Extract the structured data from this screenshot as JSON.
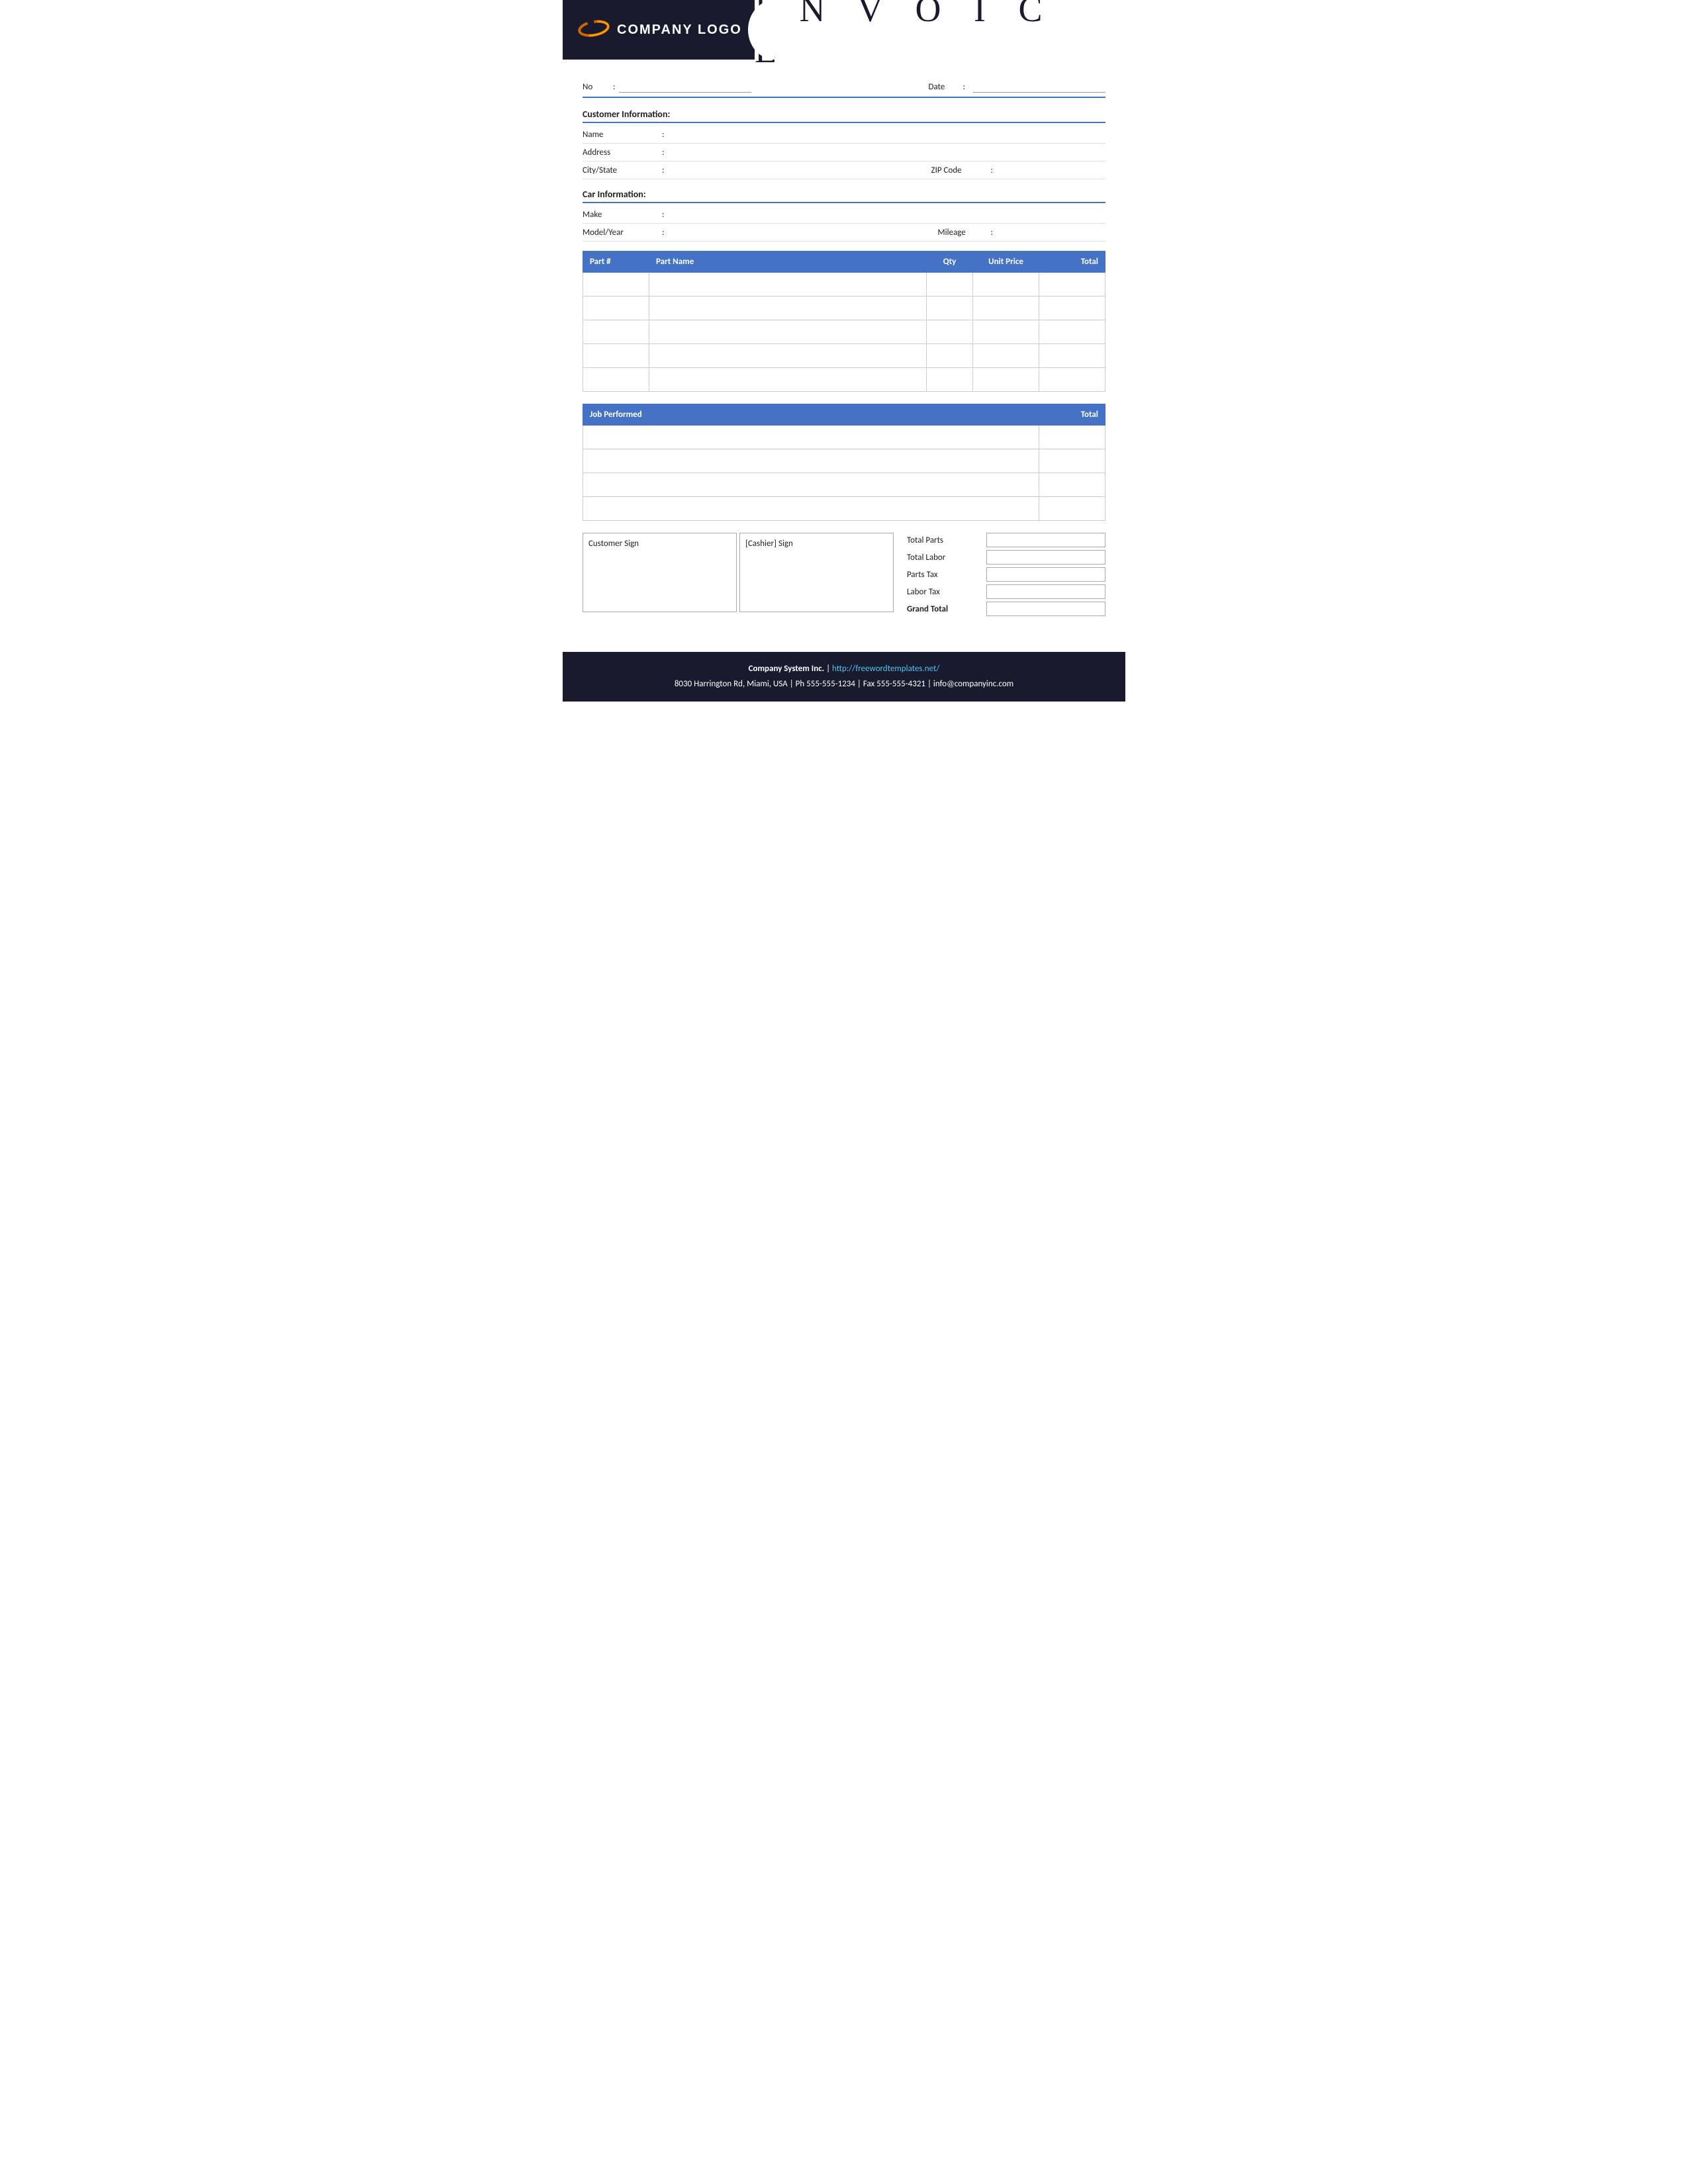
{
  "header": {
    "logo_text": "COMPANY LOGO",
    "title": "I N V O I C E"
  },
  "invoice": {
    "no_label": "No",
    "date_label": "Date",
    "colon": ":"
  },
  "customer_info": {
    "section_title": "Customer Information:",
    "name_label": "Name",
    "address_label": "Address",
    "city_state_label": "City/State",
    "zip_label": "ZIP Code"
  },
  "car_info": {
    "section_title": "Car Information:",
    "make_label": "Make",
    "model_year_label": "Model/Year",
    "mileage_label": "Mileage"
  },
  "parts_table": {
    "headers": [
      "Part #",
      "Part Name",
      "Qty",
      "Unit Price",
      "Total"
    ],
    "rows": [
      {
        "part_num": "",
        "part_name": "",
        "qty": "",
        "unit_price": "",
        "total": ""
      },
      {
        "part_num": "",
        "part_name": "",
        "qty": "",
        "unit_price": "",
        "total": ""
      },
      {
        "part_num": "",
        "part_name": "",
        "qty": "",
        "unit_price": "",
        "total": ""
      },
      {
        "part_num": "",
        "part_name": "",
        "qty": "",
        "unit_price": "",
        "total": ""
      },
      {
        "part_num": "",
        "part_name": "",
        "qty": "",
        "unit_price": "",
        "total": ""
      }
    ]
  },
  "job_table": {
    "headers": [
      "Job Performed",
      "Total"
    ],
    "rows": [
      {
        "job": "",
        "total": ""
      },
      {
        "job": "",
        "total": ""
      },
      {
        "job": "",
        "total": ""
      },
      {
        "job": "",
        "total": ""
      }
    ]
  },
  "signatures": {
    "customer_sign": "Customer Sign",
    "cashier_sign": "[Cashier] Sign"
  },
  "totals": {
    "total_parts_label": "Total Parts",
    "total_labor_label": "Total Labor",
    "parts_tax_label": "Parts Tax",
    "labor_tax_label": "Labor Tax",
    "grand_total_label": "Grand Total"
  },
  "footer": {
    "company_name": "Company System Inc.",
    "separator": "|",
    "website": "http://freewordtemplates.net/",
    "address_line": "8030 Harrington Rd, Miami, USA | Ph 555-555-1234 | Fax 555-555-4321 | info@companyinc.com"
  },
  "colors": {
    "header_bg": "#1a1a2e",
    "accent": "#4472c4",
    "white": "#ffffff"
  }
}
